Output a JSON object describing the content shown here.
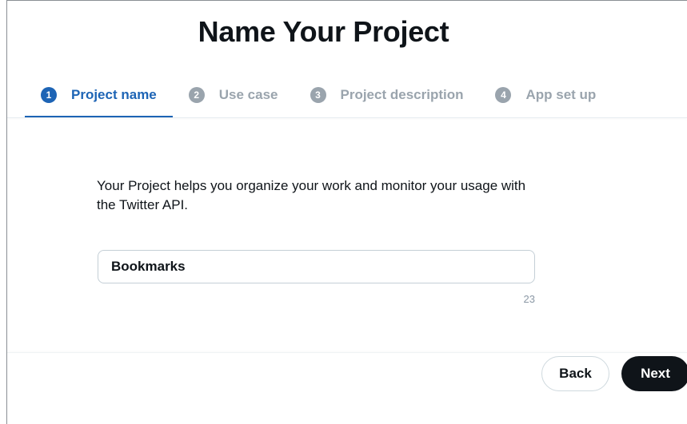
{
  "page": {
    "title": "Name Your Project"
  },
  "steps": [
    {
      "number": "1",
      "label": "Project name",
      "active": true
    },
    {
      "number": "2",
      "label": "Use case",
      "active": false
    },
    {
      "number": "3",
      "label": "Project description",
      "active": false
    },
    {
      "number": "4",
      "label": "App set up",
      "active": false
    }
  ],
  "form": {
    "description": "Your Project helps you organize your work and monitor your usage with the Twitter API.",
    "project_name_value": "Bookmarks",
    "char_counter": "23"
  },
  "footer": {
    "back_label": "Back",
    "next_label": "Next"
  },
  "colors": {
    "accent": "#1d64b5",
    "inactive": "#9aa4ad",
    "primary_button": "#0f1419"
  }
}
